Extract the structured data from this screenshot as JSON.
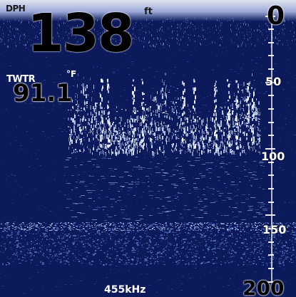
{
  "readout": {
    "depth_label": "DPH",
    "depth_value": "138",
    "unit": "ft",
    "temp_label": "TWTR",
    "temp_unit": "°F",
    "temp_value": "91.1",
    "frequency": "455kHz"
  },
  "depth_scale": {
    "labels": [
      "0",
      "50",
      "100",
      "150",
      "200"
    ],
    "range_max": 200
  },
  "colors": {
    "background": "#0c1a5c",
    "echo": "#dce8ff",
    "bottom": "#5a78c8"
  }
}
